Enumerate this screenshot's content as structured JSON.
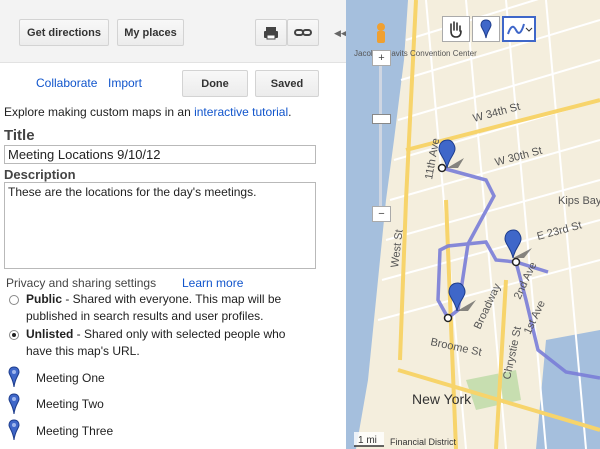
{
  "toolbar": {
    "get_directions": "Get directions",
    "my_places": "My places",
    "print_icon": "print-icon",
    "link_icon": "link-icon",
    "collapse_icon": "collapse-panel-icon"
  },
  "actions": {
    "collaborate": "Collaborate",
    "import": "Import",
    "done": "Done",
    "saved": "Saved"
  },
  "intro": {
    "prefix": "Explore making custom maps in an ",
    "link": "interactive tutorial",
    "suffix": "."
  },
  "title_section": {
    "label": "Title",
    "value": "Meeting Locations 9/10/12"
  },
  "description_section": {
    "label": "Description",
    "value": "These are the locations for the day's meetings."
  },
  "privacy": {
    "heading": "Privacy and sharing settings",
    "learn_more": "Learn more",
    "options": [
      {
        "name": "Public",
        "desc": " - Shared with everyone. This map will be",
        "desc2": "published in search results and user profiles.",
        "selected": false
      },
      {
        "name": "Unlisted",
        "desc": " - Shared only with selected people who",
        "desc2": "have this map's URL.",
        "selected": true
      }
    ]
  },
  "placemarks": [
    "Meeting One",
    "Meeting Two",
    "Meeting Three"
  ],
  "map": {
    "tools": [
      "hand-icon",
      "placemark-icon",
      "line-tool-icon"
    ],
    "labels": {
      "w34": "W 34th St",
      "w30": "W 30th St",
      "e23": "E 23rd St",
      "kips": "Kips Bay",
      "ave11": "11th Ave",
      "west": "West St",
      "broadway": "Broadway",
      "first": "1st Ave",
      "second": "2nd Ave",
      "broome": "Broome St",
      "chrystie": "Chrystie St",
      "newyork": "New York",
      "convention": "Jacob K. Javits Convention Center",
      "scale": "1 mi",
      "financial": "Financial District"
    },
    "colors": {
      "water": "#a5bfdd",
      "route": "#7a7ed8",
      "highway": "#f7d46b",
      "road": "#ffffff",
      "land": "#f4eedd",
      "park": "#c7deb0"
    }
  }
}
